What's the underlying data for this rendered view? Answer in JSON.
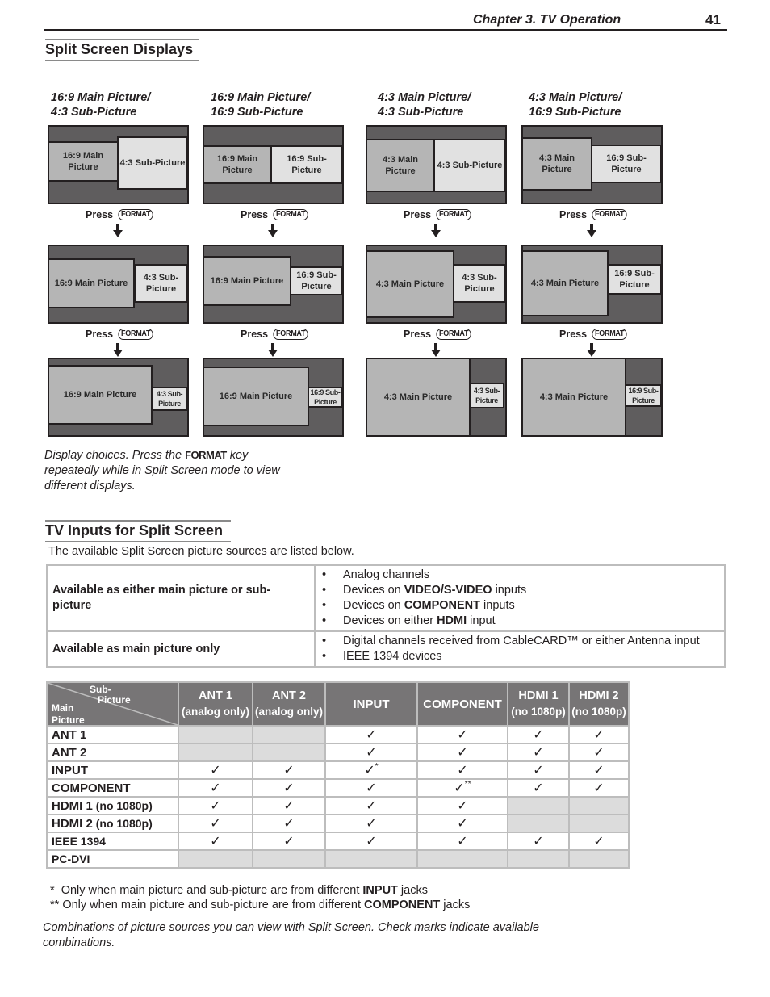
{
  "header": {
    "chapter": "Chapter 3. TV Operation",
    "page_number": "41"
  },
  "split_screen_displays": {
    "title": "Split Screen Displays",
    "press_label": "Press",
    "format_key": "FORMAT",
    "columns": [
      {
        "heading_line1": "16:9 Main Picture/",
        "heading_line2": "4:3 Sub-Picture",
        "steps": [
          {
            "main": "16:9 Main Picture",
            "sub": "4:3 Sub-Picture"
          },
          {
            "main": "16:9 Main Picture",
            "sub": "4:3 Sub-Picture"
          },
          {
            "main": "16:9 Main Picture",
            "sub": "4:3 Sub-Picture"
          }
        ]
      },
      {
        "heading_line1": "16:9 Main Picture/",
        "heading_line2": "16:9 Sub-Picture",
        "steps": [
          {
            "main": "16:9 Main Picture",
            "sub": "16:9 Sub-Picture"
          },
          {
            "main": "16:9 Main Picture",
            "sub": "16:9 Sub-Picture"
          },
          {
            "main": "16:9 Main Picture",
            "sub": "16:9 Sub-Picture"
          }
        ]
      },
      {
        "heading_line1": "4:3 Main Picture/",
        "heading_line2": "4:3 Sub-Picture",
        "steps": [
          {
            "main": "4:3 Main Picture",
            "sub": "4:3 Sub-Picture"
          },
          {
            "main": "4:3 Main Picture",
            "sub": "4:3 Sub-Picture"
          },
          {
            "main": "4:3 Main Picture",
            "sub": "4:3 Sub-Picture"
          }
        ]
      },
      {
        "heading_line1": "4:3 Main Picture/",
        "heading_line2": "16:9 Sub-Picture",
        "steps": [
          {
            "main": "4:3 Main Picture",
            "sub": "16:9 Sub-Picture"
          },
          {
            "main": "4:3 Main Picture",
            "sub": "16:9 Sub-Picture"
          },
          {
            "main": "4:3 Main Picture",
            "sub": "16:9 Sub-Picture"
          }
        ]
      }
    ],
    "caption_part1": "Display choices.  Press the ",
    "caption_key": "FORMAT",
    "caption_part2": " key repeatedly while in Split Screen mode to view different displays."
  },
  "tv_inputs": {
    "title": "TV Inputs for Split Screen",
    "intro": "The available Split Screen picture sources are listed below.",
    "sources": [
      {
        "label": "Available as either main picture or sub-picture",
        "items": [
          {
            "pre": "Analog channels",
            "bold": "",
            "post": ""
          },
          {
            "pre": "Devices on ",
            "bold": "VIDEO/S-VIDEO",
            "post": " inputs"
          },
          {
            "pre": "Devices on ",
            "bold": "COMPONENT",
            "post": " inputs"
          },
          {
            "pre": "Devices on either ",
            "bold": "HDMI",
            "post": " input"
          }
        ]
      },
      {
        "label": "Available as main picture only",
        "items": [
          {
            "pre": "Digital channels received from CableCARD™ or either Antenna input",
            "bold": "",
            "post": ""
          },
          {
            "pre": "IEEE 1394 devices",
            "bold": "",
            "post": ""
          }
        ]
      }
    ],
    "matrix": {
      "corner_sub": "Sub-",
      "corner_picture": "Picture",
      "corner_main": "Main",
      "corner_main_picture": "Picture",
      "columns": [
        {
          "line1": "ANT 1",
          "line2": "(analog only)"
        },
        {
          "line1": "ANT 2",
          "line2": "(analog only)"
        },
        {
          "line1": "INPUT",
          "line2": ""
        },
        {
          "line1": "COMPONENT",
          "line2": ""
        },
        {
          "line1": "HDMI 1",
          "line2": "(no 1080p)"
        },
        {
          "line1": "HDMI 2",
          "line2": "(no 1080p)"
        }
      ],
      "check_mark": "✓",
      "rows": [
        {
          "label": "ANT 1",
          "label_suffix": "",
          "cells": [
            "na",
            "na",
            "yes",
            "yes",
            "yes",
            "yes"
          ]
        },
        {
          "label": "ANT 2",
          "label_suffix": "",
          "cells": [
            "na",
            "na",
            "yes",
            "yes",
            "yes",
            "yes"
          ]
        },
        {
          "label": "INPUT",
          "label_suffix": "",
          "cells": [
            "yes",
            "yes",
            "yes*",
            "yes",
            "yes",
            "yes"
          ]
        },
        {
          "label": "COMPONENT",
          "label_suffix": "",
          "cells": [
            "yes",
            "yes",
            "yes",
            "yes**",
            "yes",
            "yes"
          ]
        },
        {
          "label": "HDMI 1",
          "label_suffix": " (no 1080p)",
          "cells": [
            "yes",
            "yes",
            "yes",
            "yes",
            "na",
            "na"
          ]
        },
        {
          "label": "HDMI 2",
          "label_suffix": " (no 1080p)",
          "cells": [
            "yes",
            "yes",
            "yes",
            "yes",
            "na",
            "na"
          ]
        },
        {
          "label": "IEEE 1394",
          "label_suffix": "",
          "cells": [
            "yes",
            "yes",
            "yes",
            "yes",
            "yes",
            "yes"
          ]
        },
        {
          "label": "PC-DVI",
          "label_suffix": "",
          "cells": [
            "na",
            "na",
            "na",
            "na",
            "na",
            "na"
          ]
        }
      ]
    },
    "footnotes": [
      {
        "mark": "*  ",
        "pre": "Only when main picture and sub-picture are from different ",
        "bold": "INPUT",
        "post": " jacks"
      },
      {
        "mark": "** ",
        "pre": "Only when main picture and sub-picture are from different ",
        "bold": "COMPONENT",
        "post": " jacks"
      }
    ],
    "caption": "Combinations of picture sources you can view with Split Screen. Check marks indicate available combinations."
  }
}
